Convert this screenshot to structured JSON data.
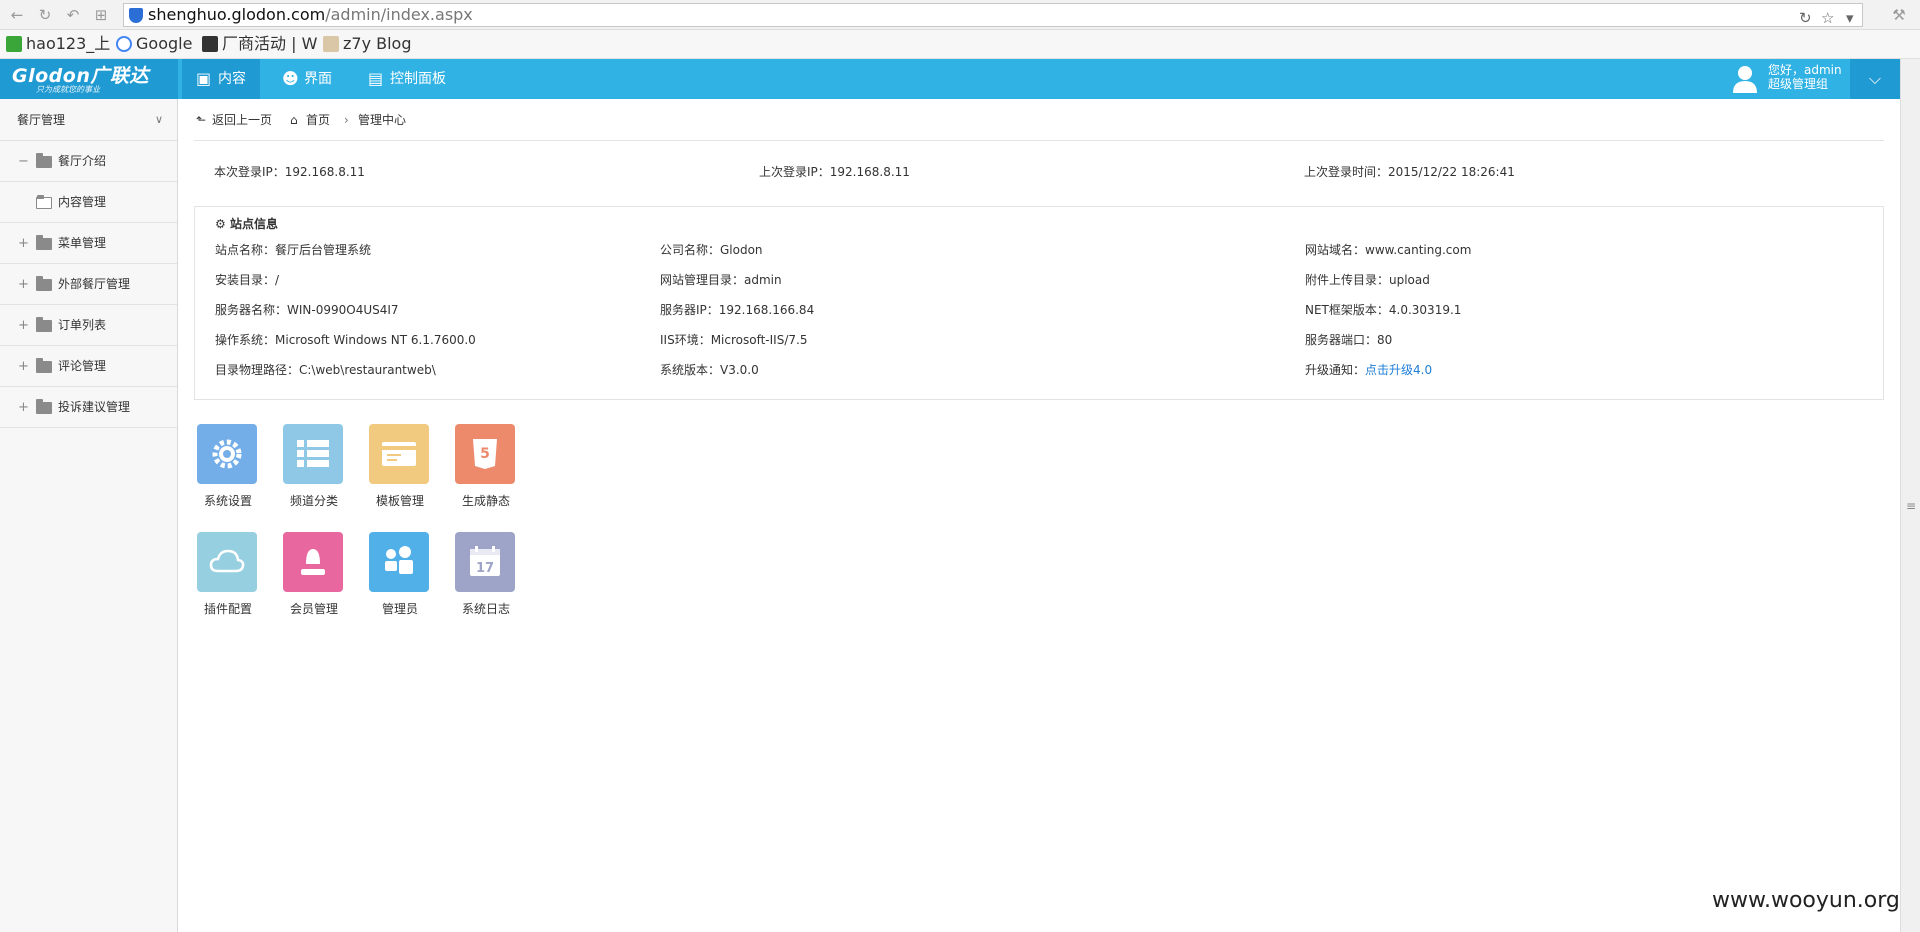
{
  "browser": {
    "url_host": "shenghuo.glodon.com",
    "url_path": "/admin/index.aspx",
    "bookmarks": [
      "hao123_上",
      "Google",
      "厂商活动 | W",
      "z7y Blog"
    ]
  },
  "header": {
    "brand": "Glodon广联达",
    "slogan": "只为成就您的事业",
    "nav": [
      {
        "label": "内容",
        "icon": "monitor-icon",
        "active": true
      },
      {
        "label": "界面",
        "icon": "user-icon",
        "active": false
      },
      {
        "label": "控制面板",
        "icon": "dashboard-icon",
        "active": false
      }
    ],
    "user_greeting": "您好，admin",
    "user_group": "超级管理组",
    "accent": "#31b2e4",
    "accent_dark": "#1f9ad2"
  },
  "sidebar": {
    "title": "餐厅管理",
    "items": [
      {
        "label": "餐厅介绍",
        "toggle": "−",
        "sub": false
      },
      {
        "label": "内容管理",
        "toggle": "",
        "sub": true
      },
      {
        "label": "菜单管理",
        "toggle": "+",
        "sub": false
      },
      {
        "label": "外部餐厅管理",
        "toggle": "+",
        "sub": false
      },
      {
        "label": "订单列表",
        "toggle": "+",
        "sub": false
      },
      {
        "label": "评论管理",
        "toggle": "+",
        "sub": false
      },
      {
        "label": "投诉建议管理",
        "toggle": "+",
        "sub": false
      }
    ]
  },
  "breadcrumb": {
    "back": "返回上一页",
    "home": "首页",
    "current": "管理中心"
  },
  "login_info": {
    "current_ip": "本次登录IP：192.168.8.11",
    "last_ip": "上次登录IP：192.168.8.11",
    "last_time": "上次登录时间：2015/12/22 18:26:41"
  },
  "site_info": {
    "title": "站点信息",
    "rows": [
      [
        "站点名称：餐厅后台管理系统",
        "公司名称：Glodon",
        "网站域名：www.canting.com"
      ],
      [
        "安装目录：/",
        "网站管理目录：admin",
        "附件上传目录：upload"
      ],
      [
        "服务器名称：WIN-0990O4US4I7",
        "服务器IP：192.168.166.84",
        "NET框架版本：4.0.30319.1"
      ],
      [
        "操作系统：Microsoft Windows NT 6.1.7600.0",
        "IIS环境：Microsoft-IIS/7.5",
        "服务器端口：80"
      ],
      [
        "目录物理路径：C:\\web\\restaurantweb\\",
        "系统版本：V3.0.0",
        "升级通知："
      ]
    ],
    "upgrade_link": "点击升级4.0"
  },
  "tiles": [
    {
      "label": "系统设置",
      "icon": "gear-icon",
      "color": "#73aee8"
    },
    {
      "label": "频道分类",
      "icon": "list-icon",
      "color": "#8ec8e6"
    },
    {
      "label": "模板管理",
      "icon": "card-icon",
      "color": "#f1c97f"
    },
    {
      "label": "生成静态",
      "icon": "html5-icon",
      "color": "#ee8a6c"
    },
    {
      "label": "插件配置",
      "icon": "cloud-icon",
      "color": "#96cfe0"
    },
    {
      "label": "会员管理",
      "icon": "member-icon",
      "color": "#e8679f"
    },
    {
      "label": "管理员",
      "icon": "admins-icon",
      "color": "#52b0e8"
    },
    {
      "label": "系统日志",
      "icon": "calendar-icon",
      "color": "#9da4c8"
    }
  ],
  "watermark": "www.wooyun.org"
}
